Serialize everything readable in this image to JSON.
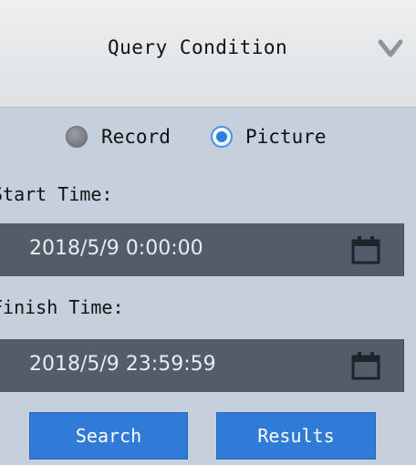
{
  "header": {
    "title": "Query Condition",
    "collapse_icon": "chevron-down-icon"
  },
  "mode": {
    "options": [
      {
        "label": "Record",
        "selected": false
      },
      {
        "label": "Picture",
        "selected": true
      }
    ]
  },
  "start_time": {
    "label": "Start Time:",
    "value": "2018/5/9 0:00:00",
    "icon": "calendar-icon"
  },
  "finish_time": {
    "label": "Finish Time:",
    "value": "2018/5/9 23:59:59",
    "icon": "calendar-icon"
  },
  "actions": {
    "search_label": "Search",
    "results_label": "Results"
  },
  "colors": {
    "panel_bg": "#c6d0dd",
    "field_bg": "#535c69",
    "button_bg": "#2f7bd6",
    "radio_selected": "#2d7de4"
  }
}
